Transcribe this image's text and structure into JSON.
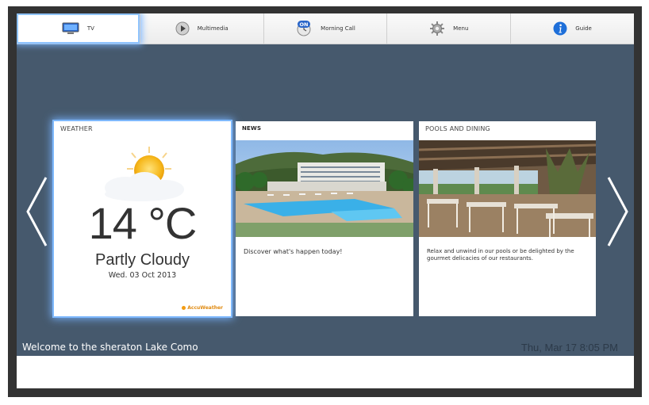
{
  "nav": {
    "items": [
      {
        "label": "TV",
        "icon": "tv-icon",
        "active": true
      },
      {
        "label": "Multimedia",
        "icon": "play-icon",
        "active": false
      },
      {
        "label": "Morning Call",
        "icon": "alarm-on-icon",
        "badge": "ON",
        "active": false
      },
      {
        "label": "Menu",
        "icon": "gear-icon",
        "active": false
      },
      {
        "label": "Guide",
        "icon": "info-icon",
        "active": false
      }
    ]
  },
  "weather": {
    "title": "WEATHER",
    "temperature": "14 °C",
    "condition": "Partly Cloudy",
    "date": "Wed. 03 Oct 2013",
    "provider": "AccuWeather",
    "icon": "partly-cloudy-icon"
  },
  "news": {
    "title": "NEWS",
    "text": "Discover what's happen today!"
  },
  "pools": {
    "title": "POOLS AND DINING",
    "text": "Relax and unwind in our pools or be delighted by the gourmet delicacies of our restaurants."
  },
  "footer": {
    "welcome": "Welcome to the sheraton Lake Como",
    "clock": "Thu, Mar 17 8:05 PM"
  },
  "colors": {
    "background": "#46596d",
    "focus_glow": "#7fb9ff",
    "accent_info": "#1e6fd9",
    "provider": "#e08a10"
  }
}
